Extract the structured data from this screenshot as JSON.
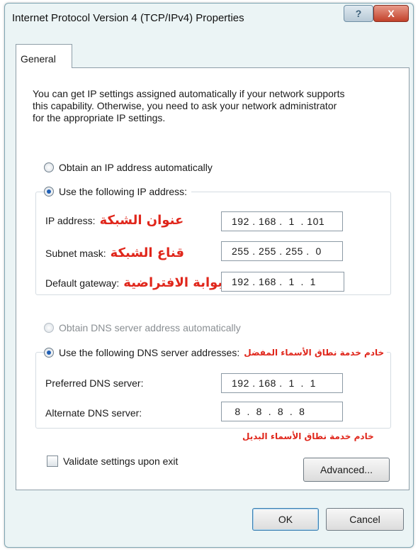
{
  "window": {
    "title": "Internet Protocol Version 4 (TCP/IPv4) Properties",
    "help_label": "?",
    "close_label": "X"
  },
  "tabs": {
    "general": "General"
  },
  "description": "You can get IP settings assigned automatically if your network supports\nthis capability. Otherwise, you need to ask your network administrator\nfor the appropriate IP settings.",
  "ip": {
    "auto_label": "Obtain an IP address automatically",
    "manual_label": "Use the following IP address:",
    "selected": "manual",
    "address_label": "IP address:",
    "address_ar": "عنوان الشبكة",
    "address_value": "192 . 168 .  1  . 101",
    "subnet_label": "Subnet mask:",
    "subnet_ar": "قناع الشبكة",
    "subnet_value": "255 . 255 . 255 .  0",
    "gateway_label": "Default gateway:",
    "gateway_ar": "البوابة الافتراضية",
    "gateway_value": "192 . 168 .  1  .  1"
  },
  "dns": {
    "auto_label": "Obtain DNS server address automatically",
    "manual_label": "Use the following DNS server addresses:",
    "manual_ar": "خادم خدمة نطاق الأسماء المفضل",
    "selected": "manual",
    "preferred_label": "Preferred DNS server:",
    "preferred_value": "192 . 168 .  1  .  1",
    "alternate_label": "Alternate DNS server:",
    "alternate_value": " 8  .  8  .  8  .  8",
    "alternate_ar": "خادم خدمة نطاق الأسماء البديل"
  },
  "validate_label": "Validate settings upon exit",
  "buttons": {
    "advanced": "Advanced...",
    "ok": "OK",
    "cancel": "Cancel"
  },
  "colors": {
    "annotation": "#e0261b",
    "accent": "#1f5fb5"
  }
}
